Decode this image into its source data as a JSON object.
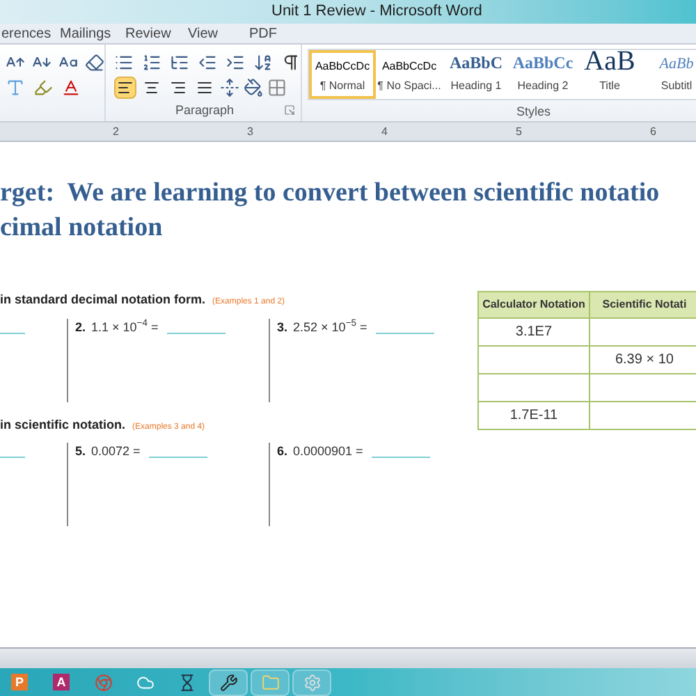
{
  "window": {
    "title": "Unit 1 Review - Microsoft Word"
  },
  "tabs": [
    {
      "label": "erences",
      "selected": false
    },
    {
      "label": "Mailings",
      "selected": false
    },
    {
      "label": "Review",
      "selected": false
    },
    {
      "label": "View",
      "selected": false
    },
    {
      "label": "PDF",
      "selected": false
    }
  ],
  "paragraph_group": {
    "label": "Paragraph",
    "alignments": [
      {
        "selected": true
      },
      {
        "selected": false
      },
      {
        "selected": false
      },
      {
        "selected": false
      }
    ]
  },
  "styles_group": {
    "label": "Styles",
    "styles": [
      {
        "preview": "AaBbCcDc",
        "name": "¶ Normal",
        "kind": "normal",
        "selected": true
      },
      {
        "preview": "AaBbCcDc",
        "name": "¶ No Spaci...",
        "kind": "normal",
        "selected": false
      },
      {
        "preview": "AaBbC",
        "name": "Heading 1",
        "kind": "heading1",
        "selected": false
      },
      {
        "preview": "AaBbCc",
        "name": "Heading 2",
        "kind": "heading2",
        "selected": false
      },
      {
        "preview": "AaB",
        "name": "Title",
        "kind": "title",
        "selected": false
      },
      {
        "preview": "AaBb",
        "name": "Subtitl",
        "kind": "subtitle",
        "selected": false
      }
    ]
  },
  "ruler": {
    "numbers": [
      "2",
      "3",
      "4",
      "5",
      "6"
    ]
  },
  "document": {
    "heading": [
      "rget:  We are learning to convert between scientific notatio",
      "cimal notation"
    ],
    "sections": [
      {
        "title": "in standard decimal notation form.",
        "note": "(Examples 1 and 2)",
        "problems": [
          {
            "kind": "blank"
          },
          {
            "kind": "problem",
            "number": "2.",
            "expression": "1.1 × 10$^{−4}$ ="
          },
          {
            "kind": "problem",
            "number": "3.",
            "expression": "2.52 × 10$^{−5}$ ="
          }
        ]
      },
      {
        "title": "in scientific notation.",
        "note": "(Examples 3 and 4)",
        "problems": [
          {
            "kind": "blank"
          },
          {
            "kind": "problem",
            "number": "5.",
            "expression": "0.0072 ="
          },
          {
            "kind": "problem",
            "number": "6.",
            "expression": "0.0000901 ="
          }
        ]
      }
    ],
    "table": {
      "columns": [
        "Calculator Notation",
        "Scientific Notati"
      ],
      "rows": [
        [
          "3.1E7",
          ""
        ],
        [
          "",
          "6.39 × 10"
        ],
        [
          "",
          ""
        ],
        [
          "1.7E-11",
          ""
        ]
      ]
    }
  },
  "taskbar": [
    {
      "kind": "letter",
      "label": "P",
      "color": "#e8792b",
      "running": false
    },
    {
      "kind": "letter",
      "label": "A",
      "color": "#b0296b",
      "running": false
    },
    {
      "kind": "chrome",
      "running": false
    },
    {
      "kind": "cloud",
      "running": false
    },
    {
      "kind": "hourglass",
      "running": false
    },
    {
      "kind": "tool",
      "running": true
    },
    {
      "kind": "folder",
      "running": true
    },
    {
      "kind": "gear",
      "running": true
    }
  ]
}
